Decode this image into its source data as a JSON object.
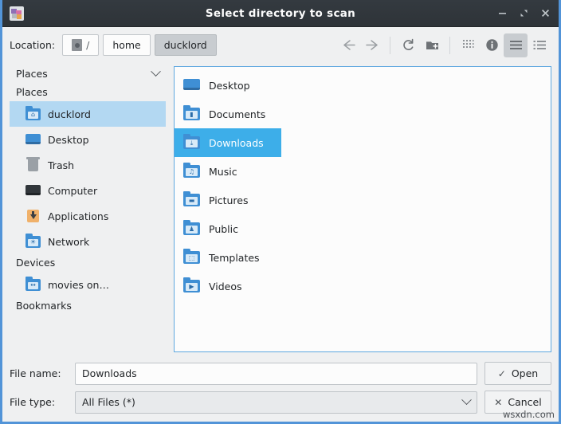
{
  "window": {
    "title": "Select directory to scan",
    "app_icon": "disk-usage-icon",
    "buttons": {
      "minimize": "−",
      "maximize": "maximize-icon",
      "close": "✕"
    }
  },
  "toolbar": {
    "location_label": "Location:",
    "breadcrumbs": [
      {
        "label": "/",
        "icon": "drive-icon",
        "active": false
      },
      {
        "label": "home",
        "icon": "",
        "active": false
      },
      {
        "label": "ducklord",
        "icon": "",
        "active": true
      }
    ],
    "actions": [
      {
        "name": "back-button",
        "icon": "arrow-left-icon",
        "pressed": false
      },
      {
        "name": "forward-button",
        "icon": "arrow-right-icon",
        "pressed": false
      },
      {
        "name": "reload-button",
        "icon": "reload-icon",
        "pressed": false
      },
      {
        "name": "new-folder-button",
        "icon": "new-folder-icon",
        "pressed": false
      },
      {
        "name": "icon-view-button",
        "icon": "grid-dots-icon",
        "pressed": false
      },
      {
        "name": "info-button",
        "icon": "info-circle-icon",
        "pressed": false
      },
      {
        "name": "compact-view-button",
        "icon": "hamburger-bars-icon",
        "pressed": true
      },
      {
        "name": "detail-view-button",
        "icon": "list-bullets-icon",
        "pressed": false
      }
    ]
  },
  "sidebar": {
    "header": "Places",
    "groups": [
      {
        "label": "Places",
        "items": [
          {
            "label": "ducklord",
            "icon": "home-folder-icon",
            "selected": true
          },
          {
            "label": "Desktop",
            "icon": "desktop-monitor-icon",
            "selected": false
          },
          {
            "label": "Trash",
            "icon": "trash-icon",
            "selected": false
          },
          {
            "label": "Computer",
            "icon": "computer-icon",
            "selected": false
          },
          {
            "label": "Applications",
            "icon": "applications-icon",
            "selected": false
          },
          {
            "label": "Network",
            "icon": "network-folder-icon",
            "selected": false
          }
        ]
      },
      {
        "label": "Devices",
        "items": [
          {
            "label": "movies on…",
            "icon": "remote-folder-icon",
            "selected": false
          }
        ]
      },
      {
        "label": "Bookmarks",
        "items": []
      }
    ]
  },
  "filelist": {
    "items": [
      {
        "label": "Desktop",
        "icon": "desktop-monitor-icon",
        "emblem": "",
        "selected": false
      },
      {
        "label": "Documents",
        "icon": "documents-folder-icon",
        "emblem": "▮",
        "selected": false
      },
      {
        "label": "Downloads",
        "icon": "downloads-folder-icon",
        "emblem": "⤓",
        "selected": true
      },
      {
        "label": "Music",
        "icon": "music-folder-icon",
        "emblem": "♫",
        "selected": false
      },
      {
        "label": "Pictures",
        "icon": "pictures-folder-icon",
        "emblem": "▬",
        "selected": false
      },
      {
        "label": "Public",
        "icon": "public-folder-icon",
        "emblem": "♟",
        "selected": false
      },
      {
        "label": "Templates",
        "icon": "templates-folder-icon",
        "emblem": "⬚",
        "selected": false
      },
      {
        "label": "Videos",
        "icon": "videos-folder-icon",
        "emblem": "▶",
        "selected": false
      }
    ]
  },
  "bottom": {
    "filename_label": "File name:",
    "filename_value": "Downloads",
    "filename_placeholder": "",
    "filetype_label": "File type:",
    "filetype_value": "All Files (*)",
    "filetype_options": [
      "All Files (*)"
    ],
    "open_label": "Open",
    "open_icon": "✓",
    "cancel_label": "Cancel",
    "cancel_icon": "✕"
  },
  "watermark": "wsxdn.com",
  "colors": {
    "titlebar": "#31363b",
    "window_border": "#5294d8",
    "background": "#eff0f1",
    "selection_strong": "#3daee9",
    "selection_soft": "#b3d8f2",
    "folder_blue": "#3f8fd4",
    "applications_orange": "#f0b16a"
  }
}
